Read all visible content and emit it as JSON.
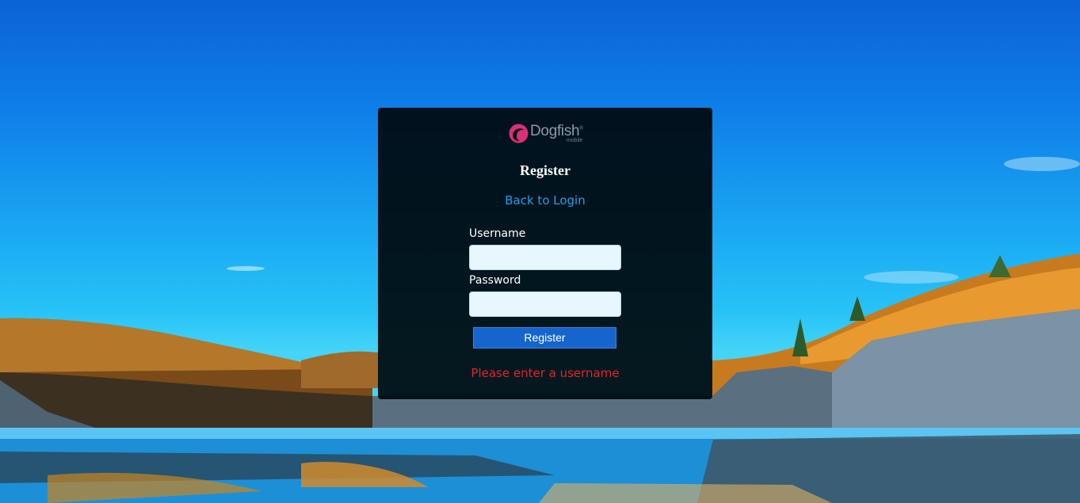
{
  "logo": {
    "name": "Dogfish",
    "registered_mark": "®",
    "subtitle": "mobile",
    "icon": "dogfish-logo-icon"
  },
  "form": {
    "title": "Register",
    "back_link": "Back to Login",
    "username_label": "Username",
    "username_value": "",
    "password_label": "Password",
    "password_value": "",
    "submit_label": "Register",
    "error_message": "Please enter a username"
  },
  "colors": {
    "panel_bg": "#000a0e",
    "link": "#2b9be6",
    "button": "#1565cc",
    "error": "#e0242c",
    "logo_accent": "#d8307a"
  }
}
